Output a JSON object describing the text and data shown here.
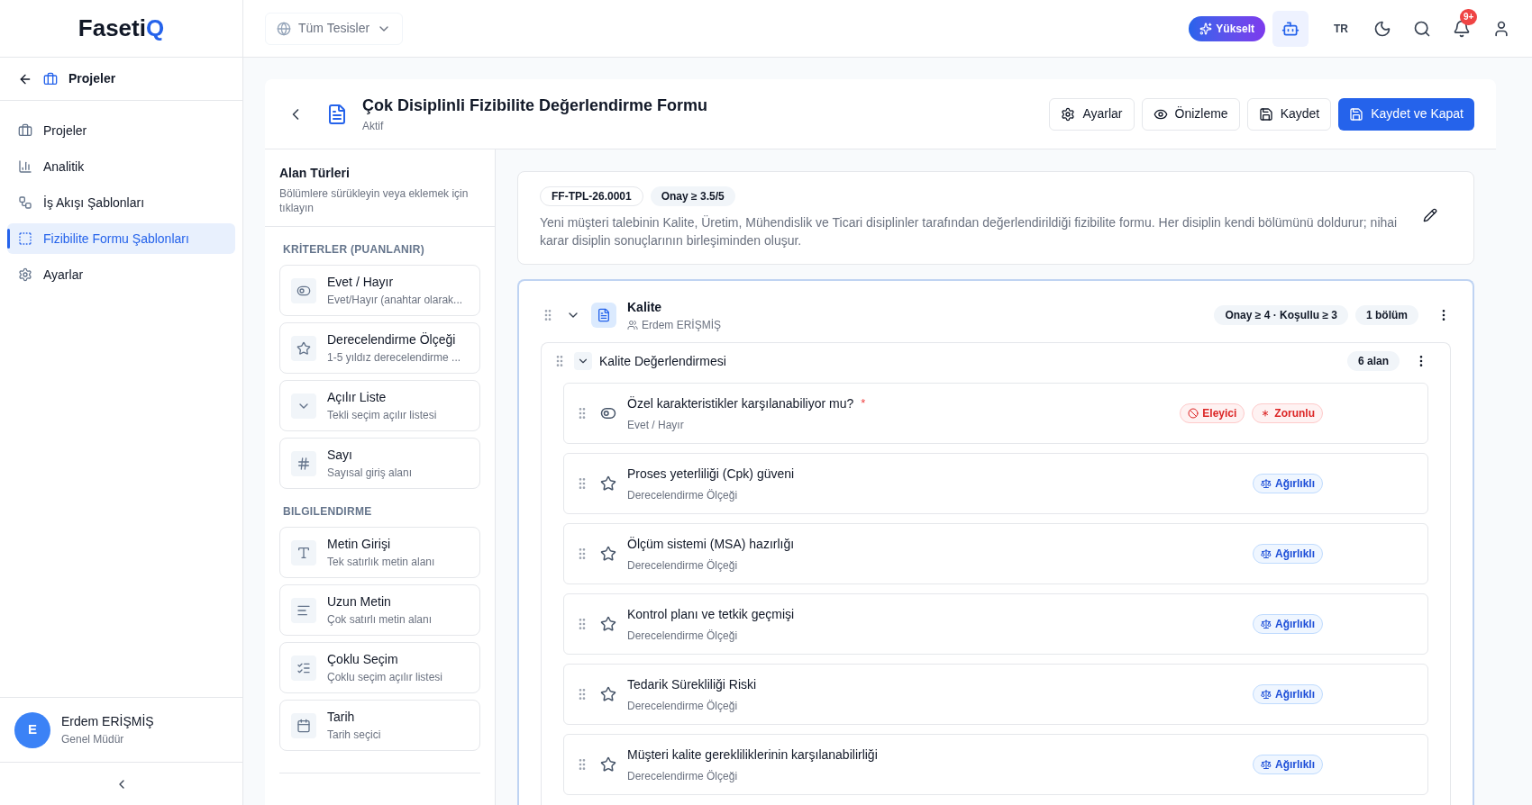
{
  "logo": {
    "text": "Faseti",
    "mark": "Q"
  },
  "sidebar": {
    "back_label": "Projeler",
    "items": [
      {
        "label": "Projeler",
        "selected": false
      },
      {
        "label": "Analitik",
        "selected": false
      },
      {
        "label": "İş Akışı Şablonları",
        "selected": false
      },
      {
        "label": "Fizibilite Formu Şablonları",
        "selected": true
      },
      {
        "label": "Ayarlar",
        "selected": false
      }
    ],
    "user": {
      "initial": "E",
      "name": "Erdem ERİŞMİŞ",
      "role": "Genel Müdür"
    }
  },
  "topbar": {
    "facility": "Tüm Tesisler",
    "upgrade": "Yükselt",
    "language": "TR",
    "notifications": "9+"
  },
  "header": {
    "title": "Çok Disiplinli Fizibilite Değerlendirme Formu",
    "status": "Aktif",
    "buttons": [
      {
        "label": "Ayarlar",
        "kind": "settings"
      },
      {
        "label": "Önizleme",
        "kind": "preview"
      },
      {
        "label": "Kaydet",
        "kind": "save"
      },
      {
        "label": "Kaydet ve Kapat",
        "kind": "primary"
      }
    ]
  },
  "field_types": {
    "title": "Alan Türleri",
    "hint": "Bölümlere sürükleyin veya eklemek için tıklayın",
    "groups": [
      {
        "title": "KRİTERLER (PUANLANIR)",
        "items": [
          {
            "kind": "boolean",
            "label": "Evet / Hayır",
            "description": "Evet/Hayır (anahtar olarak..."
          },
          {
            "kind": "rating",
            "label": "Derecelendirme Ölçeği",
            "description": "1-5 yıldız derecelendirme ..."
          },
          {
            "kind": "dropdown",
            "label": "Açılır Liste",
            "description": "Tekli seçim açılır listesi"
          },
          {
            "kind": "number",
            "label": "Sayı",
            "description": "Sayısal giriş alanı"
          }
        ]
      },
      {
        "title": "BILGILENDIRME",
        "items": [
          {
            "kind": "text",
            "label": "Metin Girişi",
            "description": "Tek satırlık metin alanı"
          },
          {
            "kind": "textarea",
            "label": "Uzun Metin",
            "description": "Çok satırlı metin alanı"
          },
          {
            "kind": "multiselect",
            "label": "Çoklu Seçim",
            "description": "Çoklu seçim açılır listesi"
          },
          {
            "kind": "date",
            "label": "Tarih",
            "description": "Tarih seçici"
          }
        ]
      }
    ]
  },
  "form": {
    "code": "FF-TPL-26.0001",
    "approval": "Onay ≥ 3.5/5",
    "description": "Yeni müşteri talebinin Kalite, Üretim, Mühendislik ve Ticari disiplinler tarafından değerlendirildiği fizibilite formu. Her disiplin kendi bölümünü doldurur; nihai karar disiplin sonuçlarının birleşiminden oluşur."
  },
  "discipline": {
    "name": "Kalite",
    "owner": "Erdem ERİŞMİŞ",
    "threshold": "Onay ≥ 4 · Koşullu ≥ 3",
    "section_count": "1 bölüm",
    "expanded": true,
    "section": {
      "title": "Kalite Değerlendirmesi",
      "field_count": "6 alan",
      "expanded": true,
      "fields": [
        {
          "kind": "boolean",
          "title": "Özel karakteristikler karşılanabiliyor mu?",
          "type": "Evet / Hayır",
          "required_mark": "*",
          "badges": [
            {
              "kind": "eliminator",
              "label": "Eleyici"
            },
            {
              "kind": "required",
              "label": "Zorunlu"
            }
          ]
        },
        {
          "kind": "rating",
          "title": "Proses yeterliliği (Cpk) güveni",
          "type": "Derecelendirme Ölçeği",
          "badges": [
            {
              "kind": "weighted",
              "label": "Ağırlıklı"
            }
          ]
        },
        {
          "kind": "rating",
          "title": "Ölçüm sistemi (MSA) hazırlığı",
          "type": "Derecelendirme Ölçeği",
          "badges": [
            {
              "kind": "weighted",
              "label": "Ağırlıklı"
            }
          ]
        },
        {
          "kind": "rating",
          "title": "Kontrol planı ve tetkik geçmişi",
          "type": "Derecelendirme Ölçeği",
          "badges": [
            {
              "kind": "weighted",
              "label": "Ağırlıklı"
            }
          ]
        },
        {
          "kind": "rating",
          "title": "Tedarik Sürekliliği Riski",
          "type": "Derecelendirme Ölçeği",
          "badges": [
            {
              "kind": "weighted",
              "label": "Ağırlıklı"
            }
          ]
        },
        {
          "kind": "rating",
          "title": "Müşteri kalite gerekliliklerinin karşılanabilirliği",
          "type": "Derecelendirme Ölçeği",
          "badges": [
            {
              "kind": "weighted",
              "label": "Ağırlıklı"
            }
          ]
        }
      ]
    }
  }
}
